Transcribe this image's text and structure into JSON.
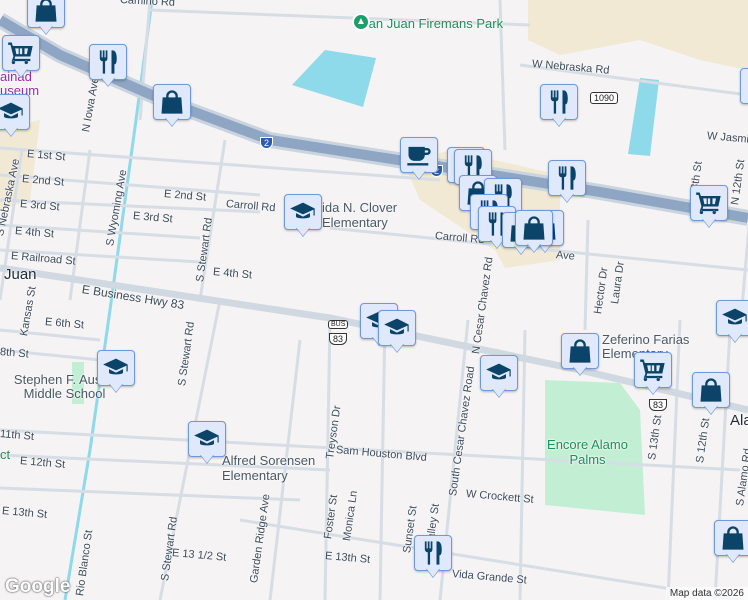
{
  "map": {
    "colors": {
      "background": "#f5f3f3",
      "highway": "#8ea6c4",
      "water": "#8ed9ea",
      "park": "#c2efd4",
      "commercial": "#f1e9d4",
      "marker_fill": "#dfe9fb",
      "marker_icon": "#0b4468"
    },
    "city_labels": [
      "Juan",
      "Ala"
    ],
    "poi_labels": {
      "park": "San Juan Firemans Park",
      "museum": "ainad useum",
      "clover": "ida N. Clover Elementary",
      "austin": "Stephen F. Austin Middle School",
      "sorensen": "Alfred Sorensen Elementary",
      "farias": "Zeferino Farias Elementary",
      "encore": "Encore Alamo Palms",
      "district": "ct"
    },
    "streets": [
      "W Nebraska Rd",
      "E 1st St",
      "E 2nd St",
      "E 3rd St",
      "E 4th St",
      "E Railroad St",
      "Carroll Rd",
      "E Business Hwy 83",
      "E 6th St",
      "8th St",
      "11th St",
      "E 12th St",
      "E 13th St",
      "Sam Houston Blvd",
      "W Crockett St",
      "E 13 1/2 St",
      "Vida Grande St",
      "S Nebraska Ave",
      "N Iowa Ave",
      "S Wyoming Ave",
      "S Stewart Rd",
      "Kansas St",
      "Garden Ridge Ave",
      "Treyson Dr",
      "Foster St",
      "Monica Ln",
      "Sunset St",
      "Valley St",
      "South Cesar Chavez Road",
      "N Cesar Chavez Rd",
      "S 13th St",
      "S 12th St",
      "N 12th St",
      "13th St",
      "W Jasmine",
      "S Alamo Rd",
      "Rio Blanco St",
      "Laura Dr",
      "Hector Dr",
      "Ave",
      "Carroll Rd",
      "Camino Rd"
    ],
    "shields": {
      "interstate": "2",
      "farm_road": "1090",
      "bus": "BUS",
      "us83": "83"
    },
    "markers": [
      "shopping-bag",
      "shopping-cart",
      "restaurant",
      "shopping-bag",
      "school",
      "school",
      "restaurant",
      "coffee",
      "restaurant",
      "restaurant",
      "restaurant",
      "restaurant",
      "shopping-bag",
      "restaurant",
      "restaurant",
      "shopping-bag",
      "shopping-bag",
      "restaurant",
      "shopping-cart",
      "school",
      "school",
      "school",
      "shopping-bag",
      "shopping-cart",
      "school",
      "shopping-bag",
      "school",
      "school",
      "restaurant",
      "shopping-bag"
    ],
    "google_logo": "Google",
    "attribution": "Map data ©2026"
  }
}
